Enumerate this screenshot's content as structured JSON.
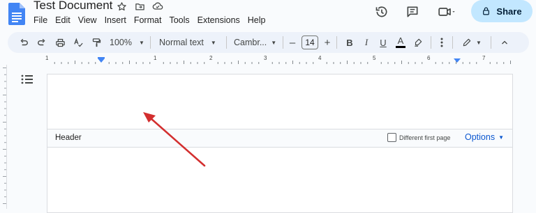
{
  "app": {
    "doc_title": "Test Document"
  },
  "menu": [
    "File",
    "Edit",
    "View",
    "Insert",
    "Format",
    "Tools",
    "Extensions",
    "Help"
  ],
  "share": {
    "label": "Share"
  },
  "toolbar": {
    "zoom": "100%",
    "style": "Normal text",
    "font": "Cambr...",
    "font_size": "14",
    "decrease": "–",
    "increase": "+",
    "bold": "B",
    "italic": "I",
    "underline": "U",
    "text_color": "A"
  },
  "ruler": {
    "numbers": [
      "1",
      "1",
      "2",
      "3",
      "4",
      "5",
      "6",
      "7"
    ]
  },
  "header": {
    "label": "Header",
    "different_first_page": "Different first page",
    "options": "Options"
  },
  "colors": {
    "accent": "#0b57d0",
    "share_bg": "#c2e7ff",
    "arrow": "#d32f2f",
    "docs_blue": "#4285f4"
  },
  "icons": [
    "docs-logo-icon",
    "star-icon",
    "move-folder-icon",
    "cloud-saved-icon",
    "history-icon",
    "comment-icon",
    "meet-icon",
    "lock-icon",
    "undo-icon",
    "redo-icon",
    "print-icon",
    "spellcheck-icon",
    "paint-format-icon",
    "more-icon",
    "editing-mode-icon",
    "collapse-icon",
    "outline-icon",
    "highlighter-icon",
    "arrow-annotation"
  ]
}
